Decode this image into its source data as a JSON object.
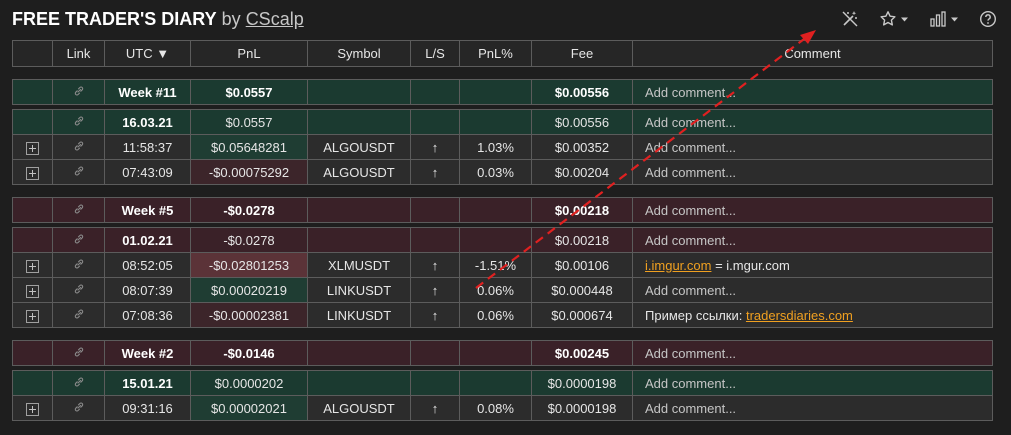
{
  "header": {
    "title": "FREE TRADER'S DIARY",
    "by": "by",
    "author": "CScalp",
    "tools": [
      "magic-wand-icon",
      "star-icon",
      "bar-chart-icon",
      "help-icon"
    ]
  },
  "columns": [
    "",
    "Link",
    "UTC ▼",
    "PnL",
    "Symbol",
    "L/S",
    "PnL%",
    "Fee",
    "Comment"
  ],
  "comment_placeholder": "Add comment...",
  "colors": {
    "positive": "#1b3a30",
    "negative": "#3a2128",
    "link": "#f0a020",
    "arrow": "#e02020"
  },
  "groups": [
    {
      "week": {
        "label": "Week #11",
        "pnl": "$0.0557",
        "fee": "$0.00556",
        "comment": "Add comment..."
      },
      "sentiment": "positive",
      "days": [
        {
          "date": "16.03.21",
          "pnl": "$0.0557",
          "fee": "$0.00556",
          "comment": "Add comment...",
          "sentiment": "positive",
          "trades": [
            {
              "time": "11:58:37",
              "pnl": "$0.05648281",
              "symbol": "ALGOUSDT",
              "ls": "↑",
              "pnl_pct": "1.03%",
              "fee": "$0.00352",
              "comment": "Add comment...",
              "sentiment": "positive"
            },
            {
              "time": "07:43:09",
              "pnl": "-$0.00075292",
              "symbol": "ALGOUSDT",
              "ls": "↑",
              "pnl_pct": "0.03%",
              "fee": "$0.00204",
              "comment": "Add comment...",
              "sentiment": "negative"
            }
          ]
        }
      ]
    },
    {
      "week": {
        "label": "Week #5",
        "pnl": "-$0.0278",
        "fee": "$0.00218",
        "comment": "Add comment..."
      },
      "sentiment": "negative",
      "days": [
        {
          "date": "01.02.21",
          "pnl": "-$0.0278",
          "fee": "$0.00218",
          "comment": "Add comment...",
          "sentiment": "negative",
          "trades": [
            {
              "time": "08:52:05",
              "pnl": "-$0.02801253",
              "symbol": "XLMUSDT",
              "ls": "↑",
              "pnl_pct": "-1.51%",
              "fee": "$0.00106",
              "comment_link": "i.imgur.com",
              "comment_text": " = i.mgur.com",
              "sentiment": "strong-negative"
            },
            {
              "time": "08:07:39",
              "pnl": "$0.00020219",
              "symbol": "LINKUSDT",
              "ls": "↑",
              "pnl_pct": "0.06%",
              "fee": "$0.000448",
              "comment": "Add comment...",
              "sentiment": "positive"
            },
            {
              "time": "07:08:36",
              "pnl": "-$0.00002381",
              "symbol": "LINKUSDT",
              "ls": "↑",
              "pnl_pct": "0.06%",
              "fee": "$0.000674",
              "comment_text": "Пример ссылки: ",
              "comment_link": "tradersdiaries.com",
              "sentiment": "negative"
            }
          ]
        }
      ]
    },
    {
      "week": {
        "label": "Week #2",
        "pnl": "-$0.0146",
        "fee": "$0.00245",
        "comment": "Add comment..."
      },
      "sentiment": "negative",
      "days": [
        {
          "date": "15.01.21",
          "pnl": "$0.0000202",
          "fee": "$0.0000198",
          "comment": "Add comment...",
          "sentiment": "positive",
          "trades": [
            {
              "time": "09:31:16",
              "pnl": "$0.00002021",
              "symbol": "ALGOUSDT",
              "ls": "↑",
              "pnl_pct": "0.08%",
              "fee": "$0.0000198",
              "comment": "Add comment...",
              "sentiment": "positive"
            }
          ]
        }
      ]
    }
  ]
}
